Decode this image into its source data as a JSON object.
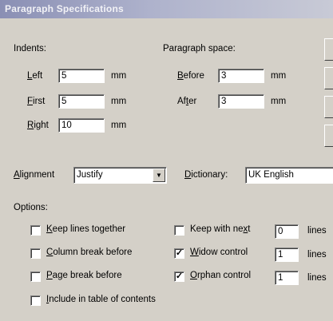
{
  "window": {
    "title": "Paragraph Specifications"
  },
  "indents": {
    "label": "Indents:",
    "left": {
      "label": "Left",
      "value": "5",
      "unit": "mm"
    },
    "first": {
      "label": "First",
      "value": "5",
      "unit": "mm"
    },
    "right": {
      "label": "Right",
      "value": "10",
      "unit": "mm"
    }
  },
  "paragraph_space": {
    "label": "Paragraph space:",
    "before": {
      "label": "Before",
      "value": "3",
      "unit": "mm"
    },
    "after": {
      "label": "After",
      "value": "3",
      "unit": "mm"
    }
  },
  "alignment": {
    "label": "Alignment",
    "value": "Justify"
  },
  "dictionary": {
    "label": "Dictionary",
    "value": "UK English"
  },
  "options": {
    "label": "Options:",
    "keep_lines_together": {
      "label": "Keep lines together",
      "checked": false
    },
    "column_break_before": {
      "label": "Column break before",
      "checked": false
    },
    "page_break_before": {
      "label": "Page break before",
      "checked": false
    },
    "include_in_toc": {
      "label": "Include in table of contents",
      "checked": false
    },
    "keep_with_next": {
      "label": "Keep with next",
      "checked": false,
      "value": "0",
      "unit": "lines"
    },
    "widow_control": {
      "label": "Widow control",
      "checked": true,
      "value": "1",
      "unit": "lines"
    },
    "orphan_control": {
      "label": "Orphan control",
      "checked": true,
      "value": "1",
      "unit": "lines"
    }
  },
  "icons": {
    "dropdown": "chevron-down-icon",
    "check": "checkmark-icon"
  }
}
